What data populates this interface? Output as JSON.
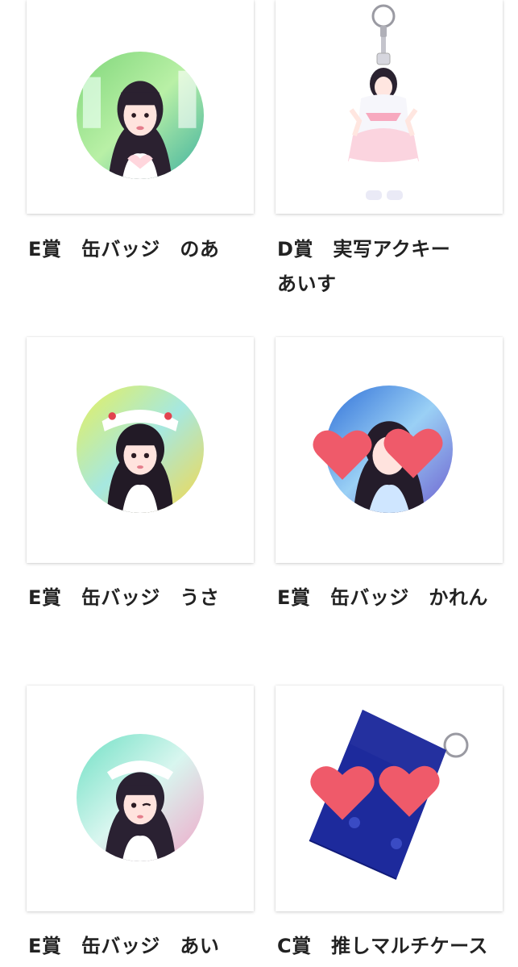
{
  "products": [
    {
      "title": "E賞　缶バッジ　のあ",
      "kind": "badge",
      "theme": "green"
    },
    {
      "title": "D賞　実写アクキー　あいす",
      "kind": "keychain",
      "theme": "pink"
    },
    {
      "title": "E賞　缶バッジ　うさ",
      "kind": "badge",
      "theme": "yellow"
    },
    {
      "title": "E賞　缶バッジ　かれん",
      "kind": "badge-hearts",
      "theme": "blue"
    },
    {
      "title": "E賞　缶バッジ　あい",
      "kind": "badge",
      "theme": "mint"
    },
    {
      "title": "C賞　推しマルチケース",
      "kind": "case-hearts",
      "theme": "navy"
    }
  ],
  "colors": {
    "heart": "#ee5a6a",
    "case": "#1d2a9c",
    "text": "#222222"
  }
}
